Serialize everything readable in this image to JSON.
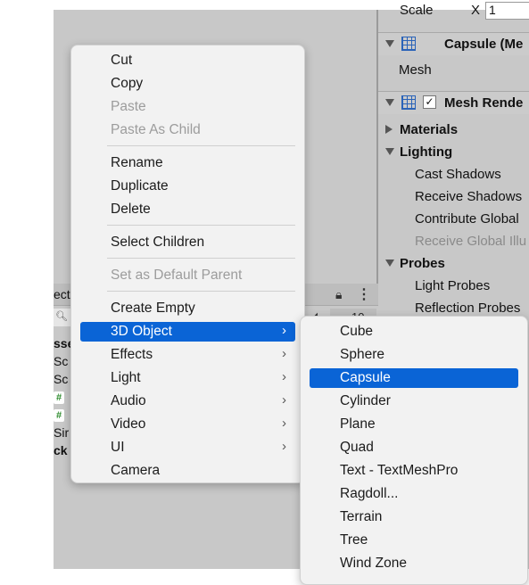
{
  "inspector": {
    "scale_label": "Scale",
    "scale_x_label": "X",
    "scale_x_value": "1",
    "mesh_filter_title": "Capsule (Me",
    "mesh_label": "Mesh",
    "mesh_renderer_title": "Mesh Rende",
    "materials_label": "Materials",
    "lighting_label": "Lighting",
    "cast_shadows": "Cast Shadows",
    "receive_shadows": "Receive Shadows",
    "contribute_gi": "Contribute Global",
    "receive_gi": "Receive Global Illu",
    "probes_label": "Probes",
    "light_probes": "Light Probes",
    "reflection_probes": "Reflection Probes"
  },
  "hierarchy": {
    "title": "ect",
    "count": "10",
    "rows": [
      "sse",
      "Sc",
      "Sc",
      "",
      "",
      "Sir",
      "ck"
    ]
  },
  "context_menu": {
    "cut": "Cut",
    "copy": "Copy",
    "paste": "Paste",
    "paste_as_child": "Paste As Child",
    "rename": "Rename",
    "duplicate": "Duplicate",
    "delete": "Delete",
    "select_children": "Select Children",
    "set_default_parent": "Set as Default Parent",
    "create_empty": "Create Empty",
    "object_3d": "3D Object",
    "effects": "Effects",
    "light": "Light",
    "audio": "Audio",
    "video": "Video",
    "ui": "UI",
    "camera": "Camera"
  },
  "submenu_3d": {
    "cube": "Cube",
    "sphere": "Sphere",
    "capsule": "Capsule",
    "cylinder": "Cylinder",
    "plane": "Plane",
    "quad": "Quad",
    "text_tmp": "Text - TextMeshPro",
    "ragdoll": "Ragdoll...",
    "terrain": "Terrain",
    "tree": "Tree",
    "wind_zone": "Wind Zone"
  },
  "colors": {
    "selection": "#0a64d6",
    "menu_bg": "#f2f2f2",
    "editor_bg": "#c8c8c8"
  }
}
